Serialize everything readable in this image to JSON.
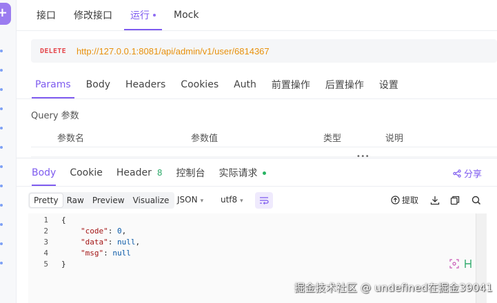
{
  "top_tabs": [
    {
      "label": "接口"
    },
    {
      "label": "修改接口"
    },
    {
      "label": "运行"
    },
    {
      "label": "Mock"
    }
  ],
  "request": {
    "method": "DELETE",
    "url": "http://127.0.0.1:8081/api/admin/v1/user/6814367"
  },
  "request_tabs": [
    {
      "label": "Params"
    },
    {
      "label": "Body"
    },
    {
      "label": "Headers"
    },
    {
      "label": "Cookies"
    },
    {
      "label": "Auth"
    },
    {
      "label": "前置操作"
    },
    {
      "label": "后置操作"
    },
    {
      "label": "设置"
    }
  ],
  "params": {
    "section_title": "Query 参数",
    "columns": [
      "参数名",
      "参数值",
      "类型",
      "说明"
    ]
  },
  "response_tabs": {
    "body": "Body",
    "cookie": "Cookie",
    "header": "Header",
    "header_count": "8",
    "console": "控制台",
    "actual_request": "实际请求"
  },
  "share_label": "分享",
  "format_buttons": [
    "Pretty",
    "Raw",
    "Preview",
    "Visualize"
  ],
  "format_select": "JSON",
  "encoding_select": "utf8",
  "extract_label": "提取",
  "code": {
    "line_numbers": [
      "1",
      "2",
      "3",
      "4",
      "5"
    ],
    "open_brace": "{",
    "close_brace": "}",
    "entries": [
      {
        "key": "\"code\"",
        "value": "0",
        "suffix": ","
      },
      {
        "key": "\"data\"",
        "value": "null",
        "suffix": ","
      },
      {
        "key": "\"msg\"",
        "value": "null",
        "suffix": ""
      }
    ]
  },
  "watermark": "掘金技术社区 @ undefined在掘金39041",
  "colors": {
    "accent": "#7e5bef",
    "method": "#e5484d",
    "url": "#e8910c",
    "success": "#28b463"
  }
}
